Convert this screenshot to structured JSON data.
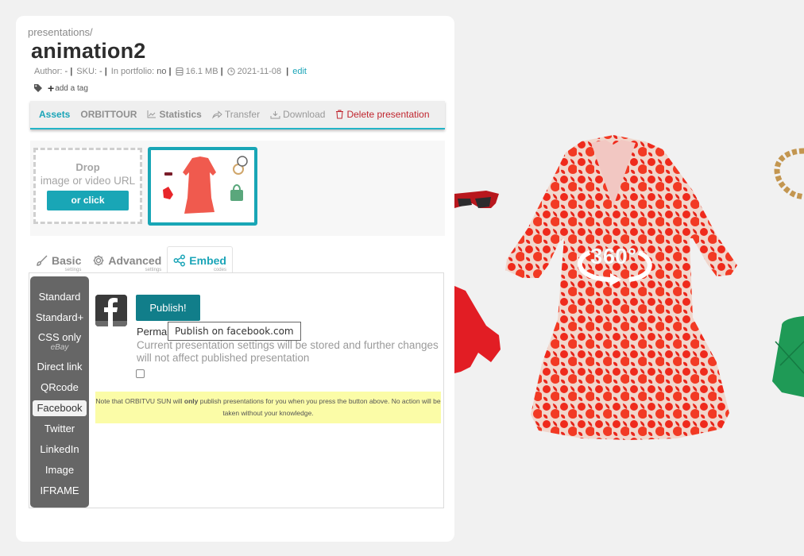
{
  "breadcrumb": "presentations/",
  "title": "animation2",
  "meta": {
    "author_label": "Author:",
    "author_value": "-",
    "sku_label": "SKU:",
    "sku_value": "-",
    "portfolio_label": "In portfolio:",
    "portfolio_value": "no",
    "size": "16.1 MB",
    "date": "2021-11-08",
    "edit_label": "edit",
    "separator": "|"
  },
  "tags": {
    "add_label": "add a tag",
    "plus": "+"
  },
  "tabbar": {
    "items": [
      {
        "label": "Assets",
        "icon": "",
        "active": true
      },
      {
        "label": "ORBITTOUR",
        "icon": ""
      },
      {
        "label": "Statistics",
        "icon": "chart-icon"
      },
      {
        "label": "Transfer",
        "icon": "share-icon"
      },
      {
        "label": "Download",
        "icon": "download-icon"
      },
      {
        "label": "Delete presentation",
        "icon": "trash-icon"
      }
    ]
  },
  "assets": {
    "drop_title": "Drop",
    "drop_subtitle": "image or video URL",
    "drop_button": "or click"
  },
  "settings_tabs": [
    {
      "label": "Basic",
      "sub": "settings",
      "icon": "brush-icon"
    },
    {
      "label": "Advanced",
      "sub": "settings",
      "icon": "gear-icon"
    },
    {
      "label": "Embed",
      "sub": "codes",
      "icon": "share-nodes-icon",
      "active": true
    }
  ],
  "embed": {
    "side_items": [
      {
        "label": "Standard"
      },
      {
        "label": "Standard+"
      },
      {
        "label": "CSS only",
        "sub": "eBay"
      },
      {
        "label": "Direct link"
      },
      {
        "label": "QRcode"
      },
      {
        "label": "Facebook",
        "active": true
      },
      {
        "label": "Twitter"
      },
      {
        "label": "LinkedIn"
      },
      {
        "label": "Image"
      },
      {
        "label": "IFRAME"
      }
    ],
    "publish_button": "Publish!",
    "tooltip": "Publish on facebook.com",
    "perma_label": "Perma",
    "perma_desc": "Current presentation settings will be stored and further changes will not affect published presentation",
    "note_before": "Note that ORBITVU SUN will ",
    "note_bold": "only",
    "note_after": " publish presentations for you when you press the button above. No action will be taken without your knowledge."
  },
  "viewer": {
    "badge": "360°"
  },
  "colors": {
    "accent": "#1ba5b8",
    "publish": "#117e8a",
    "delete": "#c0262f",
    "note_bg": "#fbfca7",
    "sidebar": "#666666"
  }
}
